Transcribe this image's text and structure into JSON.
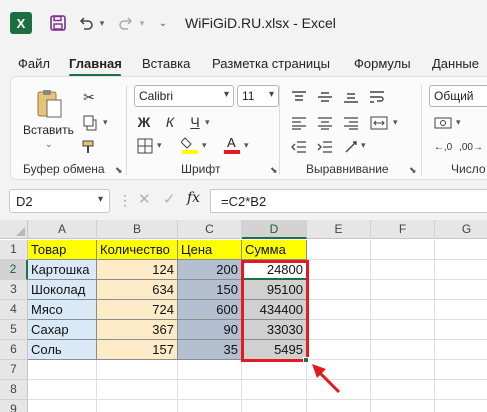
{
  "window": {
    "app_icon": "excel-icon",
    "title": "WiFiGiD.RU.xlsx  -  Excel"
  },
  "menu": {
    "tabs": [
      "Файл",
      "Главная",
      "Вставка",
      "Разметка страницы",
      "Формулы",
      "Данные"
    ],
    "active": "Главная"
  },
  "ribbon": {
    "clipboard": {
      "paste_label": "Вставить",
      "group_label": "Буфер обмена"
    },
    "font": {
      "family": "Calibri",
      "size": "11",
      "bold": "Ж",
      "italic": "К",
      "underline": "Ч",
      "group_label": "Шрифт"
    },
    "alignment": {
      "group_label": "Выравнивание"
    },
    "number": {
      "format": "Общий",
      "group_label": "Число"
    },
    "colors": {
      "fill": "#ffff00",
      "font": "#e21b23"
    }
  },
  "formula_bar": {
    "name_box": "D2",
    "fx_label": "fx",
    "formula": "=C2*B2"
  },
  "sheet": {
    "columns": [
      "A",
      "B",
      "C",
      "D",
      "E",
      "F",
      "G"
    ],
    "selected_column": "D",
    "rows": [
      "1",
      "2",
      "3",
      "4",
      "5",
      "6",
      "7",
      "8",
      "9"
    ],
    "headers": {
      "a": "Товар",
      "b": "Количество",
      "c": "Цена",
      "d": "Сумма"
    },
    "data": [
      {
        "product": "Картошка",
        "qty": "124",
        "price": "200",
        "sum": "24800"
      },
      {
        "product": "Шоколад",
        "qty": "634",
        "price": "150",
        "sum": "95100"
      },
      {
        "product": "Мясо",
        "qty": "724",
        "price": "600",
        "sum": "434400"
      },
      {
        "product": "Сахар",
        "qty": "367",
        "price": "90",
        "sum": "33030"
      },
      {
        "product": "Соль",
        "qty": "157",
        "price": "35",
        "sum": "5495"
      }
    ],
    "active_cell": "D2",
    "highlight_color": "#e21b23"
  }
}
